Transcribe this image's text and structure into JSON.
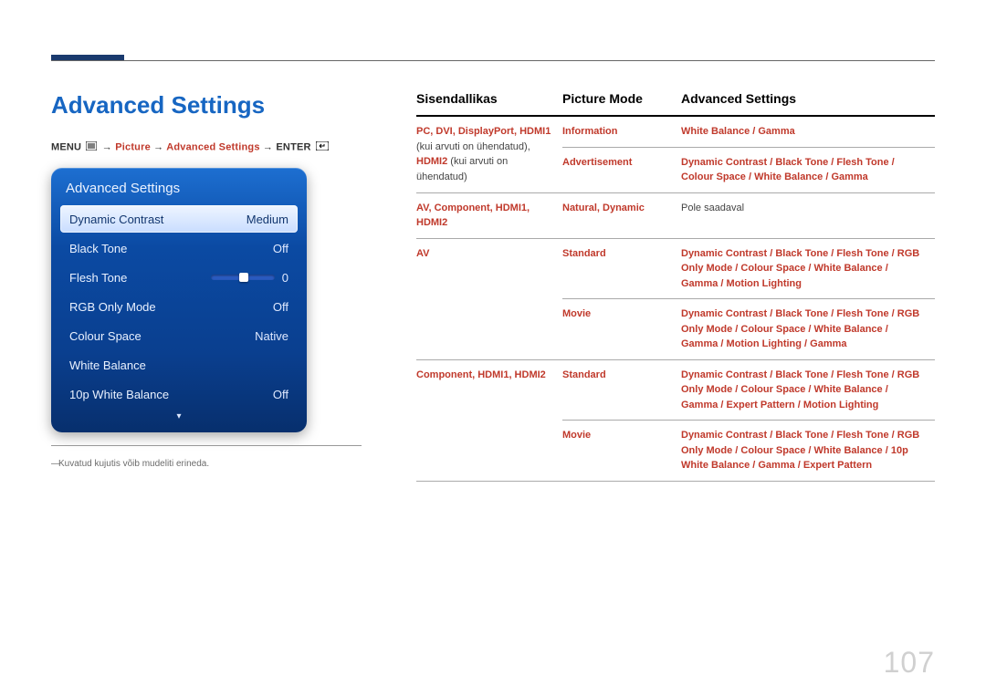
{
  "page": {
    "title": "Advanced Settings",
    "number": "107",
    "footnote": "Kuvatud kujutis võib mudeliti erineda.",
    "breadcrumb": {
      "menu": "MENU",
      "arrow": "→",
      "p1": "Picture",
      "p2": "Advanced Settings",
      "enter": "ENTER"
    }
  },
  "osd": {
    "title": "Advanced Settings",
    "rows": [
      {
        "label": "Dynamic Contrast",
        "value": "Medium",
        "selected": true
      },
      {
        "label": "Black Tone",
        "value": "Off"
      },
      {
        "label": "Flesh Tone",
        "value": "0",
        "slider": true
      },
      {
        "label": "RGB Only Mode",
        "value": "Off"
      },
      {
        "label": "Colour Space",
        "value": "Native"
      },
      {
        "label": "White Balance",
        "value": ""
      },
      {
        "label": "10p White Balance",
        "value": "Off"
      }
    ]
  },
  "table": {
    "headers": [
      "Sisendallikas",
      "Picture Mode",
      "Advanced Settings"
    ],
    "rows": [
      {
        "src_red": "PC, DVI, DisplayPort, HDMI1",
        "src_plain_1": "(kui arvuti on ühendatud),",
        "src_red_2": "HDMI2",
        "src_plain_2": " (kui arvuti on ühendatud)",
        "mode": [
          {
            "text": "Information",
            "red": true
          },
          {
            "text": "Advertisement",
            "red": true
          }
        ],
        "adv": [
          [
            {
              "t": "White Balance",
              "r": 1
            },
            {
              "t": " / ",
              "r": 1
            },
            {
              "t": "Gamma",
              "r": 1
            }
          ],
          [
            {
              "t": "Dynamic Contrast",
              "r": 1
            },
            {
              "t": " / ",
              "r": 1
            },
            {
              "t": "Black Tone",
              "r": 1
            },
            {
              "t": " / ",
              "r": 1
            },
            {
              "t": "Flesh Tone",
              "r": 1
            },
            {
              "t": " / ",
              "r": 1
            },
            {
              "t": "Colour Space",
              "r": 1
            },
            {
              "t": " / ",
              "r": 1
            },
            {
              "t": "White Balance",
              "r": 1
            },
            {
              "t": " / ",
              "r": 1
            },
            {
              "t": "Gamma",
              "r": 1
            }
          ]
        ]
      },
      {
        "src_red": "AV, Component, HDMI1, HDMI2",
        "mode": [
          {
            "text": "Natural, Dynamic",
            "red": true
          }
        ],
        "adv_plain": "Pole saadaval"
      },
      {
        "src_red": "AV",
        "mode": [
          {
            "text": "Standard",
            "red": true
          },
          {
            "text": "Movie",
            "red": true
          }
        ],
        "adv": [
          [
            {
              "t": "Dynamic Contrast",
              "r": 1
            },
            {
              "t": " / ",
              "r": 1
            },
            {
              "t": "Black Tone",
              "r": 1
            },
            {
              "t": " / ",
              "r": 1
            },
            {
              "t": "Flesh Tone",
              "r": 1
            },
            {
              "t": " / ",
              "r": 1
            },
            {
              "t": "RGB Only Mode",
              "r": 1
            },
            {
              "t": " / ",
              "r": 1
            },
            {
              "t": "Colour Space",
              "r": 1
            },
            {
              "t": " / ",
              "r": 1
            },
            {
              "t": "White Balance",
              "r": 1
            },
            {
              "t": " / ",
              "r": 1
            },
            {
              "t": "Gamma",
              "r": 1
            },
            {
              "t": " / ",
              "r": 1
            },
            {
              "t": "Motion Lighting",
              "r": 1
            }
          ],
          [
            {
              "t": "Dynamic Contrast",
              "r": 1
            },
            {
              "t": " / ",
              "r": 1
            },
            {
              "t": "Black Tone",
              "r": 1
            },
            {
              "t": " / ",
              "r": 1
            },
            {
              "t": "Flesh Tone",
              "r": 1
            },
            {
              "t": " / ",
              "r": 1
            },
            {
              "t": "RGB Only Mode",
              "r": 1
            },
            {
              "t": " / ",
              "r": 1
            },
            {
              "t": "Colour Space",
              "r": 1
            },
            {
              "t": " / ",
              "r": 1
            },
            {
              "t": "White Balance",
              "r": 1
            },
            {
              "t": " / ",
              "r": 1
            },
            {
              "t": "Gamma",
              "r": 1
            },
            {
              "t": " / ",
              "r": 1
            },
            {
              "t": "Motion Lighting",
              "r": 1
            },
            {
              "t": " / ",
              "r": 1
            },
            {
              "t": "Gamma",
              "r": 1
            }
          ]
        ]
      },
      {
        "src_red": "Component, HDMI1, HDMI2",
        "mode": [
          {
            "text": "Standard",
            "red": true
          },
          {
            "text": "Movie",
            "red": true
          }
        ],
        "adv": [
          [
            {
              "t": "Dynamic Contrast",
              "r": 1
            },
            {
              "t": " / ",
              "r": 1
            },
            {
              "t": "Black Tone",
              "r": 1
            },
            {
              "t": " / ",
              "r": 1
            },
            {
              "t": "Flesh Tone",
              "r": 1
            },
            {
              "t": " / ",
              "r": 1
            },
            {
              "t": "RGB Only Mode",
              "r": 1
            },
            {
              "t": " / ",
              "r": 1
            },
            {
              "t": "Colour Space",
              "r": 1
            },
            {
              "t": " / ",
              "r": 1
            },
            {
              "t": "White Balance",
              "r": 1
            },
            {
              "t": " / ",
              "r": 1
            },
            {
              "t": "Gamma",
              "r": 1
            },
            {
              "t": " / ",
              "r": 1
            },
            {
              "t": "Expert Pattern",
              "r": 1
            },
            {
              "t": " / ",
              "r": 1
            },
            {
              "t": "Motion Lighting",
              "r": 1
            }
          ],
          [
            {
              "t": "Dynamic Contrast",
              "r": 1
            },
            {
              "t": " / ",
              "r": 1
            },
            {
              "t": "Black Tone",
              "r": 1
            },
            {
              "t": " / ",
              "r": 1
            },
            {
              "t": "Flesh Tone",
              "r": 1
            },
            {
              "t": " / ",
              "r": 1
            },
            {
              "t": "RGB Only Mode",
              "r": 1
            },
            {
              "t": " / ",
              "r": 1
            },
            {
              "t": "Colour Space",
              "r": 1
            },
            {
              "t": " / ",
              "r": 1
            },
            {
              "t": "White Balance",
              "r": 1
            },
            {
              "t": " / ",
              "r": 1
            },
            {
              "t": "10p White Balance",
              "r": 1
            },
            {
              "t": " / ",
              "r": 1
            },
            {
              "t": "Gamma",
              "r": 1
            },
            {
              "t": " / ",
              "r": 1
            },
            {
              "t": "Expert Pattern",
              "r": 1
            }
          ]
        ]
      }
    ]
  }
}
